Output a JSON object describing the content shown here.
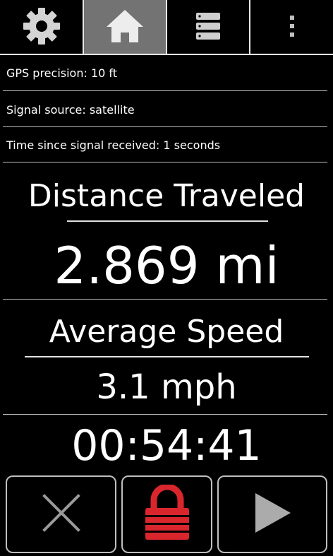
{
  "toolbar": {
    "tabs": [
      {
        "icon": "gear-icon",
        "selected": false
      },
      {
        "icon": "home-icon",
        "selected": true
      },
      {
        "icon": "list-icon",
        "selected": false
      },
      {
        "icon": "more-vertical-icon",
        "selected": false
      }
    ]
  },
  "status": {
    "gps_precision": "GPS precision: 10 ft",
    "signal_source": "Signal source: satellite",
    "time_since_signal": "Time since signal received: 1 seconds"
  },
  "distance": {
    "label": "Distance Traveled",
    "value": "2.869 mi"
  },
  "speed": {
    "label": "Average Speed",
    "value": "3.1 mph"
  },
  "timer": {
    "value": "00:54:41"
  },
  "controls": {
    "cancel_icon": "close-icon",
    "lock_icon": "lock-icon",
    "play_icon": "play-icon",
    "lock_color": "#d9262d"
  }
}
